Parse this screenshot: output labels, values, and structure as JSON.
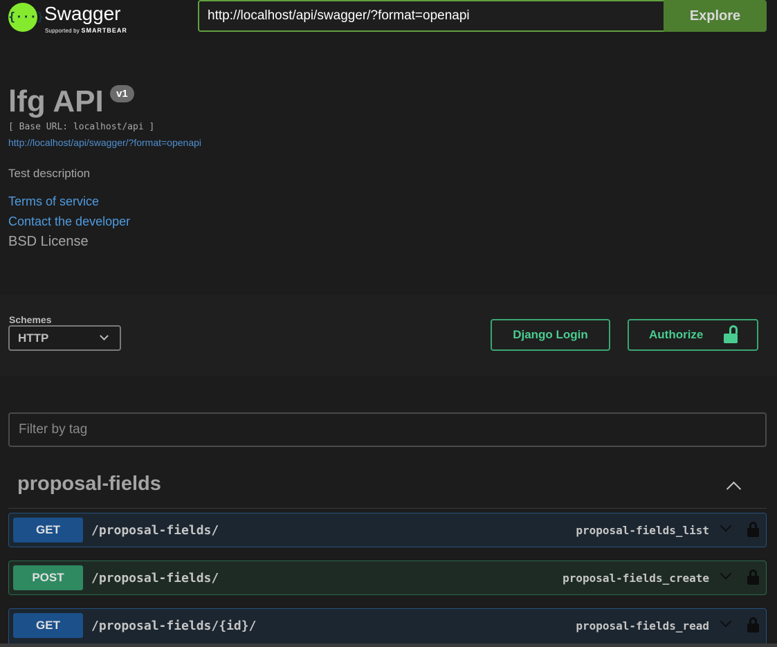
{
  "topbar": {
    "logo_glyph": "{···}",
    "logo_name": "Swagger",
    "logo_sub_prefix": "Supported by",
    "logo_sub_brand": "SMARTBEAR",
    "url_value": "http://localhost/api/swagger/?format=openapi",
    "explore_label": "Explore"
  },
  "info": {
    "title": "lfg API",
    "version": "v1",
    "base_url": "[ Base URL: localhost/api ]",
    "spec_link": "http://localhost/api/swagger/?format=openapi",
    "description": "Test description",
    "terms_of_service": "Terms of service",
    "contact": "Contact the developer",
    "license": "BSD License"
  },
  "schemes": {
    "label": "Schemes",
    "selected": "HTTP",
    "login_button": "Django Login",
    "authorize_button": "Authorize"
  },
  "filter": {
    "placeholder": "Filter by tag"
  },
  "tag": {
    "name": "proposal-fields",
    "operations": [
      {
        "method": "GET",
        "path": "/proposal-fields/",
        "operation_id": "proposal-fields_list"
      },
      {
        "method": "POST",
        "path": "/proposal-fields/",
        "operation_id": "proposal-fields_create"
      },
      {
        "method": "GET",
        "path": "/proposal-fields/{id}/",
        "operation_id": "proposal-fields_read"
      }
    ]
  },
  "colors": {
    "accent_green": "#49cc90",
    "get_blue": "#1b508a",
    "post_green": "#2f8a62",
    "explore_green": "#4d7e30",
    "logo_green": "#85ea2d"
  }
}
